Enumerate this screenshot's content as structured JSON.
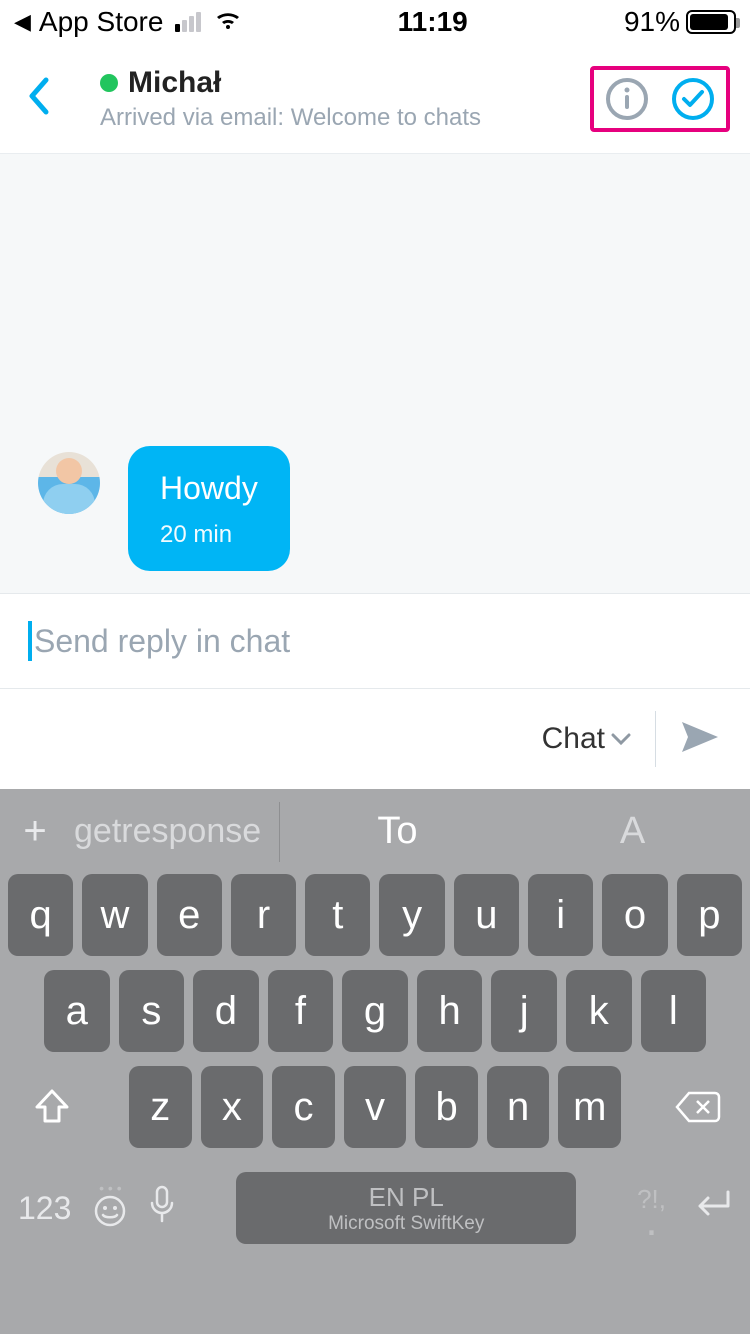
{
  "status": {
    "back_app": "App Store",
    "time": "11:19",
    "battery_pct": "91%"
  },
  "nav": {
    "name": "Michał",
    "subtitle": "Arrived via email: Welcome to chats"
  },
  "message": {
    "text": "Howdy",
    "time": "20 min"
  },
  "reply": {
    "placeholder": "Send reply in chat",
    "value": ""
  },
  "compose": {
    "mode_label": "Chat"
  },
  "keyboard": {
    "suggestions": [
      "getresponse",
      "To",
      "A"
    ],
    "row1": [
      "q",
      "w",
      "e",
      "r",
      "t",
      "y",
      "u",
      "i",
      "o",
      "p"
    ],
    "row2": [
      "a",
      "s",
      "d",
      "f",
      "g",
      "h",
      "j",
      "k",
      "l"
    ],
    "row3": [
      "z",
      "x",
      "c",
      "v",
      "b",
      "n",
      "m"
    ],
    "num_label": "123",
    "lang": "EN PL",
    "brand": "Microsoft SwiftKey",
    "punct_top": "?!,",
    "punct_bot": "."
  }
}
